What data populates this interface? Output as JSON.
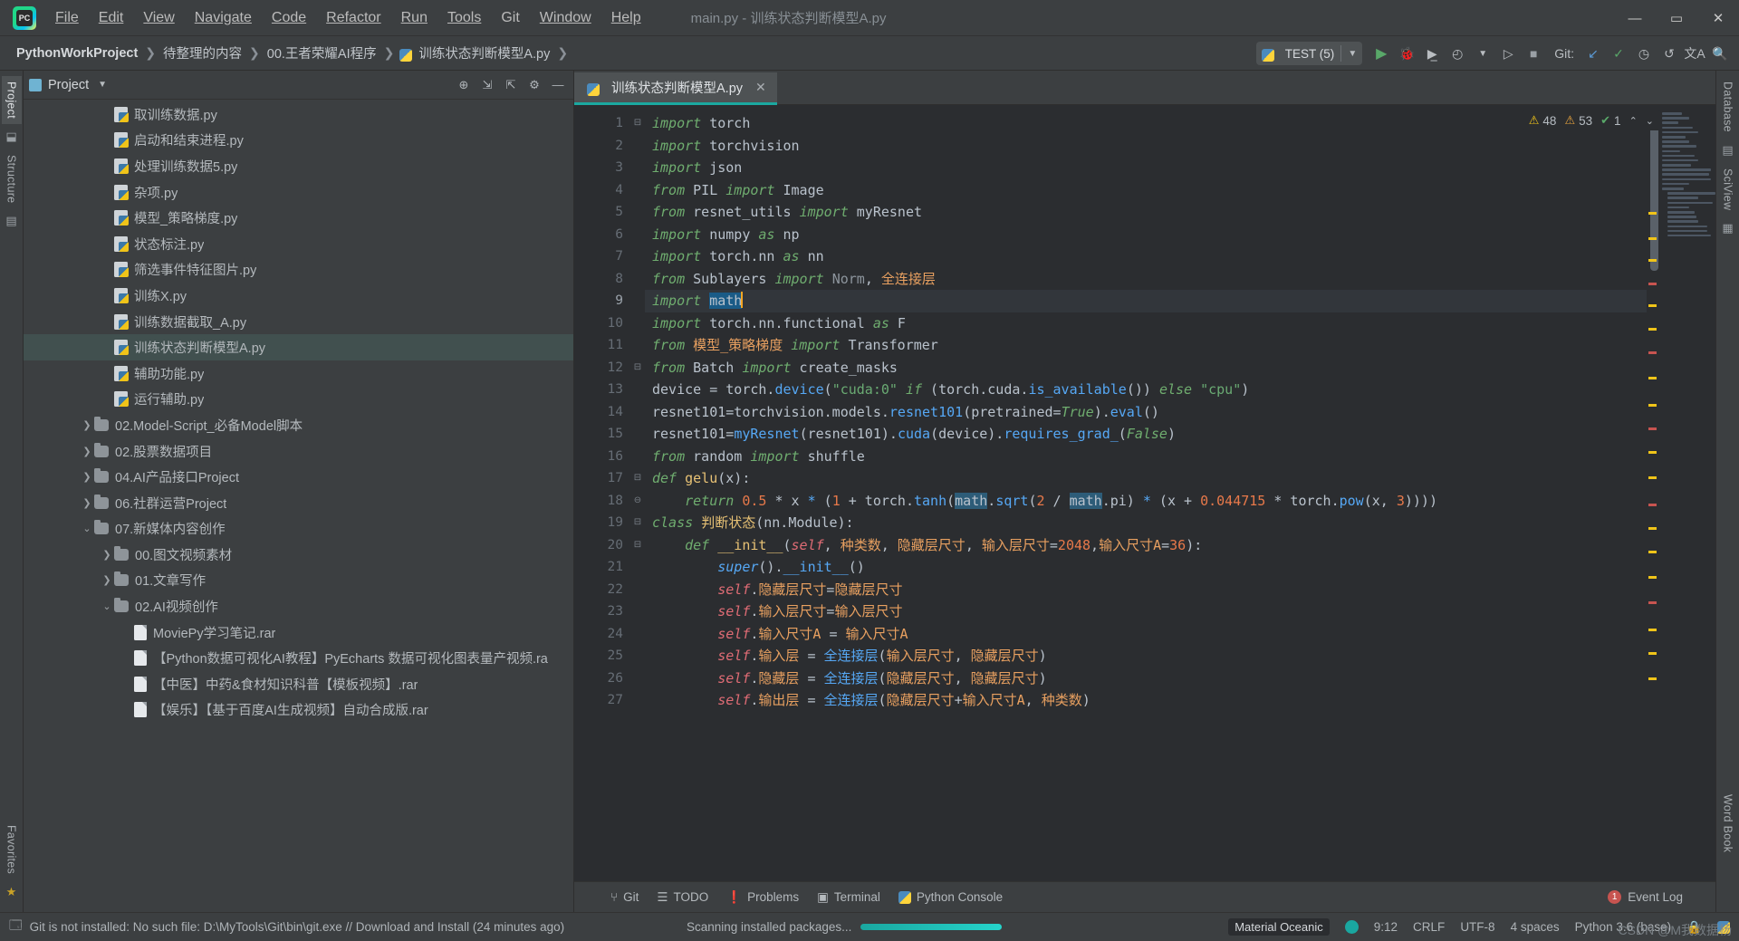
{
  "titlebar": {
    "logo": "pc-logo",
    "menus": [
      "File",
      "Edit",
      "View",
      "Navigate",
      "Code",
      "Refactor",
      "Run",
      "Tools",
      "Git",
      "Window",
      "Help"
    ],
    "window_title": "main.py - 训练状态判断模型A.py",
    "controls": {
      "minimize": "—",
      "maximize": "▭",
      "close": "✕"
    }
  },
  "navbar": {
    "breadcrumbs": [
      "PythonWorkProject",
      "待整理的内容",
      "00.王者荣耀AI程序",
      "训练状态判断模型A.py"
    ],
    "separator": "❯",
    "run_config": "TEST (5)",
    "git_label": "Git:",
    "icons": [
      "run-icon",
      "debug-icon",
      "coverage-icon",
      "profile-icon",
      "rerun-icon",
      "stop-icon",
      "git-update-icon",
      "git-commit-icon",
      "history-icon",
      "undo-icon",
      "translate-icon",
      "search-icon"
    ]
  },
  "left_strip": {
    "tabs": [
      "Project",
      "Structure"
    ],
    "bottom_tabs": [
      "Favorites"
    ]
  },
  "right_strip": {
    "tabs": [
      "Database",
      "SciView",
      "Word Book"
    ]
  },
  "project_panel": {
    "title": "Project",
    "header_icons": [
      "locate-icon",
      "expand-all-icon",
      "collapse-all-icon",
      "settings-icon",
      "hide-icon"
    ],
    "tree": [
      {
        "indent": 2,
        "type": "py",
        "label": "取训练数据.py",
        "selected": false,
        "twist": ""
      },
      {
        "indent": 2,
        "type": "py",
        "label": "启动和结束进程.py",
        "selected": false,
        "twist": ""
      },
      {
        "indent": 2,
        "type": "py",
        "label": "处理训练数据5.py",
        "selected": false,
        "twist": ""
      },
      {
        "indent": 2,
        "type": "py",
        "label": "杂项.py",
        "selected": false,
        "twist": ""
      },
      {
        "indent": 2,
        "type": "py",
        "label": "模型_策略梯度.py",
        "selected": false,
        "twist": ""
      },
      {
        "indent": 2,
        "type": "py",
        "label": "状态标注.py",
        "selected": false,
        "twist": ""
      },
      {
        "indent": 2,
        "type": "py",
        "label": "筛选事件特征图片.py",
        "selected": false,
        "twist": ""
      },
      {
        "indent": 2,
        "type": "py",
        "label": "训练X.py",
        "selected": false,
        "twist": ""
      },
      {
        "indent": 2,
        "type": "py",
        "label": "训练数据截取_A.py",
        "selected": false,
        "twist": ""
      },
      {
        "indent": 2,
        "type": "py",
        "label": "训练状态判断模型A.py",
        "selected": true,
        "twist": ""
      },
      {
        "indent": 2,
        "type": "py",
        "label": "辅助功能.py",
        "selected": false,
        "twist": ""
      },
      {
        "indent": 2,
        "type": "py",
        "label": "运行辅助.py",
        "selected": false,
        "twist": ""
      },
      {
        "indent": 1,
        "type": "folder",
        "label": "02.Model-Script_必备Model脚本",
        "selected": false,
        "twist": "❯"
      },
      {
        "indent": 1,
        "type": "folder",
        "label": "02.股票数据项目",
        "selected": false,
        "twist": "❯"
      },
      {
        "indent": 1,
        "type": "folder",
        "label": "04.AI产品接口Project",
        "selected": false,
        "twist": "❯"
      },
      {
        "indent": 1,
        "type": "folder",
        "label": "06.社群运营Project",
        "selected": false,
        "twist": "❯"
      },
      {
        "indent": 1,
        "type": "folder",
        "label": "07.新媒体内容创作",
        "selected": false,
        "twist": "⌄"
      },
      {
        "indent": 2,
        "type": "folder",
        "label": "00.图文视频素材",
        "selected": false,
        "twist": "❯"
      },
      {
        "indent": 2,
        "type": "folder",
        "label": "01.文章写作",
        "selected": false,
        "twist": "❯"
      },
      {
        "indent": 2,
        "type": "folder",
        "label": "02.AI视频创作",
        "selected": false,
        "twist": "⌄"
      },
      {
        "indent": 3,
        "type": "rar",
        "label": "MoviePy学习笔记.rar",
        "selected": false,
        "twist": ""
      },
      {
        "indent": 3,
        "type": "rar",
        "label": "【Python数据可视化AI教程】PyEcharts 数据可视化图表量产视频.ra",
        "selected": false,
        "twist": ""
      },
      {
        "indent": 3,
        "type": "rar",
        "label": "【中医】中药&食材知识科普【模板视频】.rar",
        "selected": false,
        "twist": ""
      },
      {
        "indent": 3,
        "type": "rar",
        "label": "【娱乐】【基于百度AI生成视频】自动合成版.rar",
        "selected": false,
        "twist": ""
      }
    ]
  },
  "editor": {
    "tab": {
      "label": "训练状态判断模型A.py",
      "close": "✕",
      "icon": "python-file-icon"
    },
    "inspection": {
      "warnings": "48",
      "errors": "53",
      "ok": "1",
      "up": "⌃",
      "down": "⌄"
    },
    "lines": [
      {
        "n": "1",
        "fold": "⊟",
        "text": "import torch"
      },
      {
        "n": "2",
        "fold": "",
        "text": "import torchvision"
      },
      {
        "n": "3",
        "fold": "",
        "text": "import json"
      },
      {
        "n": "4",
        "fold": "",
        "text": "from PIL import Image"
      },
      {
        "n": "5",
        "fold": "",
        "text": "from resnet_utils import myResnet"
      },
      {
        "n": "6",
        "fold": "",
        "text": "import numpy as np"
      },
      {
        "n": "7",
        "fold": "",
        "text": "import torch.nn as nn"
      },
      {
        "n": "8",
        "fold": "",
        "text": "from Sublayers import Norm, 全连接层"
      },
      {
        "n": "9",
        "fold": "",
        "text": "import math"
      },
      {
        "n": "10",
        "fold": "",
        "text": "import torch.nn.functional as F"
      },
      {
        "n": "11",
        "fold": "",
        "text": "from 模型_策略梯度 import Transformer"
      },
      {
        "n": "12",
        "fold": "⊟",
        "text": "from Batch import create_masks"
      },
      {
        "n": "13",
        "fold": "",
        "text": "device = torch.device(\"cuda:0\" if (torch.cuda.is_available()) else \"cpu\")"
      },
      {
        "n": "14",
        "fold": "",
        "text": "resnet101=torchvision.models.resnet101(pretrained=True).eval()"
      },
      {
        "n": "15",
        "fold": "",
        "text": "resnet101=myResnet(resnet101).cuda(device).requires_grad_(False)"
      },
      {
        "n": "16",
        "fold": "",
        "text": "from random import shuffle"
      },
      {
        "n": "17",
        "fold": "⊟",
        "text": "def gelu(x):"
      },
      {
        "n": "18",
        "fold": "⊖",
        "text": "    return 0.5 * x * (1 + torch.tanh(math.sqrt(2 / math.pi) * (x + 0.044715 * torch.pow(x, 3))))"
      },
      {
        "n": "19",
        "fold": "⊟",
        "text": "class 判断状态(nn.Module):"
      },
      {
        "n": "20",
        "fold": "⊟",
        "text": "    def __init__(self, 种类数, 隐藏层尺寸, 输入层尺寸=2048,输入尺寸A=36):"
      },
      {
        "n": "21",
        "fold": "",
        "text": "        super().__init__()"
      },
      {
        "n": "22",
        "fold": "",
        "text": "        self.隐藏层尺寸=隐藏层尺寸"
      },
      {
        "n": "23",
        "fold": "",
        "text": "        self.输入层尺寸=输入层尺寸"
      },
      {
        "n": "24",
        "fold": "",
        "text": "        self.输入尺寸A = 输入尺寸A"
      },
      {
        "n": "25",
        "fold": "",
        "text": "        self.输入层 = 全连接层(输入层尺寸, 隐藏层尺寸)"
      },
      {
        "n": "26",
        "fold": "",
        "text": "        self.隐藏层 = 全连接层(隐藏层尺寸, 隐藏层尺寸)"
      },
      {
        "n": "27",
        "fold": "",
        "text": "        self.输出层 = 全连接层(隐藏层尺寸+输入尺寸A, 种类数)"
      }
    ],
    "current_line": "9",
    "selected_token": "math"
  },
  "tool_window_bar": {
    "buttons": [
      {
        "icon": "git-branch-icon",
        "label": "Git"
      },
      {
        "icon": "todo-list-icon",
        "label": "TODO"
      },
      {
        "icon": "problems-icon",
        "label": "Problems"
      },
      {
        "icon": "terminal-icon",
        "label": "Terminal"
      },
      {
        "icon": "python-console-icon",
        "label": "Python Console"
      }
    ],
    "event_log": {
      "count": "1",
      "label": "Event Log"
    }
  },
  "statusbar": {
    "message": "Git is not installed: No such file: D:\\MyTools\\Git\\bin\\git.exe // Download and Install (24 minutes ago)",
    "progress_text": "Scanning installed packages...",
    "progress_percent": 100,
    "theme": "Material Oceanic",
    "position": "9:12",
    "line_sep": "CRLF",
    "encoding": "UTF-8",
    "indent": "4 spaces",
    "interpreter": "Python 3.6 (base)",
    "watermark": "CSDN @M我数据杨"
  },
  "colors": {
    "accent_teal": "#1ba8a0",
    "selection_blue": "#1a5b87",
    "highlight_blue": "#2d5c78",
    "warning": "#f0c419",
    "error": "#c75450",
    "ok_green": "#59a869",
    "panel_bg": "#3c3f41",
    "editor_bg": "#2b2d30"
  }
}
